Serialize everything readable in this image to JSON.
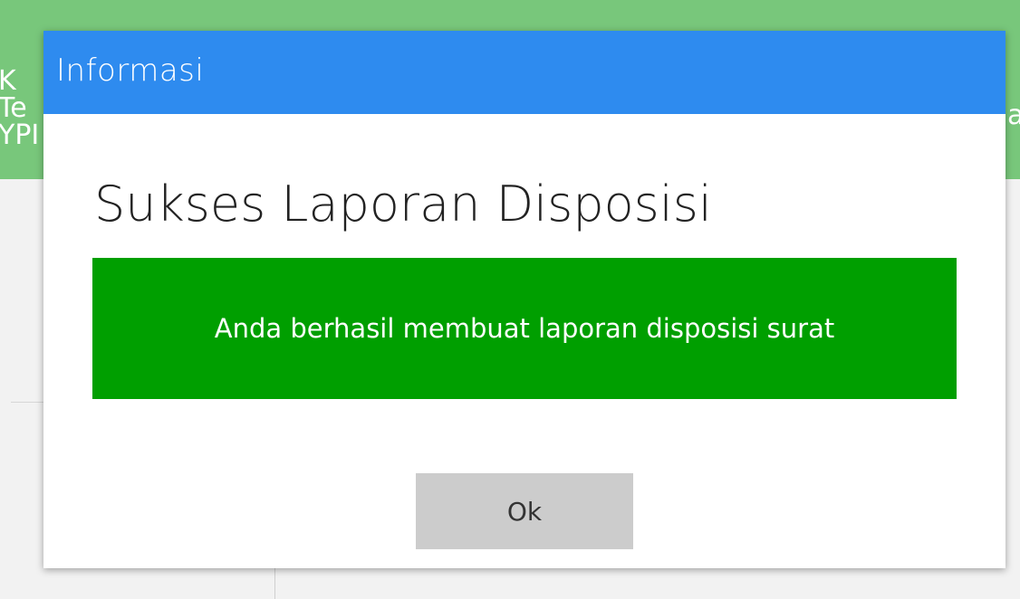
{
  "background": {
    "header_partial_lines": [
      "K",
      "Te",
      "YPI"
    ],
    "header_partial_right": "a"
  },
  "dialog": {
    "title": "Informasi",
    "heading": "Sukses Laporan Disposisi",
    "message": "Anda berhasil membuat laporan disposisi surat",
    "ok_label": "Ok"
  },
  "colors": {
    "titlebar": "#2e8bef",
    "message_bg": "#009f00",
    "header_bg": "#78c77b",
    "button_bg": "#cccccc"
  }
}
